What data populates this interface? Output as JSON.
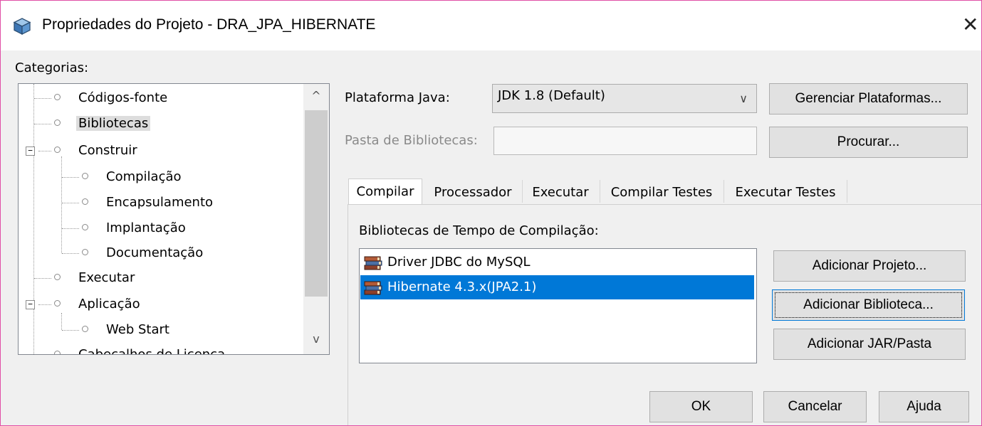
{
  "window": {
    "title": "Propriedades do Projeto - DRA_JPA_HIBERNATE",
    "close_glyph": "✕",
    "icon": "cube-icon",
    "border_color": "#e04fa6"
  },
  "categories": {
    "label": "Categorias:",
    "items": [
      {
        "label": "Códigos-fonte",
        "level": 0
      },
      {
        "label": "Bibliotecas",
        "level": 0,
        "selected": true
      },
      {
        "label": "Construir",
        "level": 0,
        "expander": "−"
      },
      {
        "label": "Compilação",
        "level": 1
      },
      {
        "label": "Encapsulamento",
        "level": 1
      },
      {
        "label": "Implantação",
        "level": 1
      },
      {
        "label": "Documentação",
        "level": 1
      },
      {
        "label": "Executar",
        "level": 0
      },
      {
        "label": "Aplicação",
        "level": 0,
        "expander": "−"
      },
      {
        "label": "Web Start",
        "level": 1
      },
      {
        "label": "Cabeçalhos de Licença",
        "level": 0
      }
    ],
    "scroll_up": "^",
    "scroll_down": "v"
  },
  "platform": {
    "label": "Plataforma Java:",
    "value": "JDK 1.8 (Default)",
    "chevron": "∨",
    "manage_button": "Gerenciar Plataformas..."
  },
  "library_folder": {
    "label": "Pasta de Bibliotecas:",
    "value": "",
    "browse_button": "Procurar..."
  },
  "tabs": [
    {
      "label": "Compilar",
      "active": true
    },
    {
      "label": "Processador"
    },
    {
      "label": "Executar"
    },
    {
      "label": "Compilar Testes"
    },
    {
      "label": "Executar Testes"
    }
  ],
  "compile": {
    "list_label": "Bibliotecas de Tempo de Compilação:",
    "libraries": [
      {
        "name": "Driver JDBC do MySQL",
        "icon": "library-books-icon"
      },
      {
        "name": "Hibernate 4.3.x(JPA2.1)",
        "icon": "library-books-icon",
        "selected": true
      }
    ],
    "add_project_button": "Adicionar Projeto...",
    "add_library_button": "Adicionar Biblioteca...",
    "add_jar_button": "Adicionar JAR/Pasta"
  },
  "footer": {
    "ok": "OK",
    "cancel": "Cancelar",
    "help": "Ajuda"
  }
}
